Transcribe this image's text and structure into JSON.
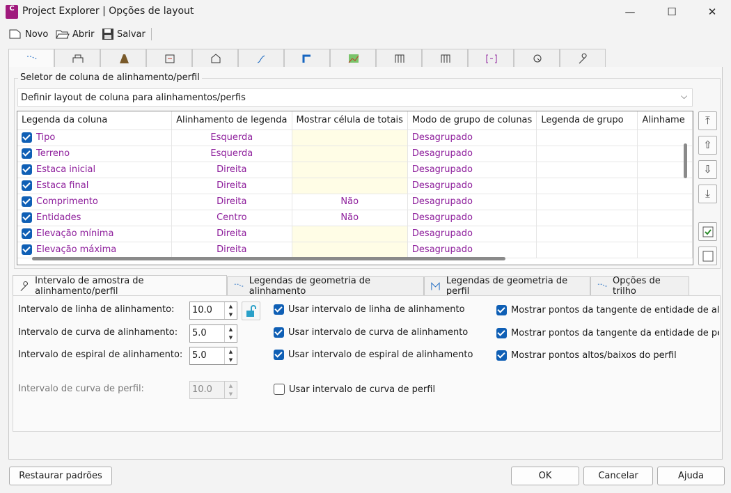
{
  "window": {
    "title": "Project Explorer | Opções de layout",
    "app_icon_text": "C",
    "min": "—",
    "max": "☐",
    "close": "✕"
  },
  "toolbar": {
    "novo": "Novo",
    "abrir": "Abrir",
    "salvar": "Salvar"
  },
  "top_tabs": [
    "alignment-tab-icon",
    "bridge-tab-icon",
    "corridor-tab-icon",
    "assembly-tab-icon",
    "surface-tab-icon",
    "profile-tab-icon",
    "pipe-tab-icon",
    "sample-lines-tab-icon",
    "section-views-tab-icon",
    "structures-tab-icon",
    "station-tab-icon",
    "point-tab-icon",
    "tools-tab-icon"
  ],
  "selector": {
    "legend": "Seletor de coluna de alinhamento/perfil",
    "value": "Definir layout de coluna para alinhamentos/perfis"
  },
  "grid": {
    "headers": [
      "Legenda da coluna",
      "Alinhamento de legenda",
      "Mostrar célula de totais",
      "Modo de grupo de colunas",
      "Legenda de grupo",
      "Alinhame"
    ],
    "rows": [
      {
        "name": "Tipo",
        "align": "Esquerda",
        "totals": "",
        "group": "Desagrupado"
      },
      {
        "name": "Terreno",
        "align": "Esquerda",
        "totals": "",
        "group": "Desagrupado"
      },
      {
        "name": "Estaca inicial",
        "align": "Direita",
        "totals": "",
        "group": "Desagrupado"
      },
      {
        "name": "Estaca final",
        "align": "Direita",
        "totals": "",
        "group": "Desagrupado"
      },
      {
        "name": "Comprimento",
        "align": "Direita",
        "totals": "Não",
        "group": "Desagrupado"
      },
      {
        "name": "Entidades",
        "align": "Centro",
        "totals": "Não",
        "group": "Desagrupado"
      },
      {
        "name": "Elevação mínima",
        "align": "Direita",
        "totals": "",
        "group": "Desagrupado"
      },
      {
        "name": "Elevação máxima",
        "align": "Direita",
        "totals": "",
        "group": "Desagrupado"
      }
    ]
  },
  "side_buttons": {
    "top": "⤒",
    "up": "⇧",
    "down": "⇩",
    "bottom": "⤓"
  },
  "lower_tabs": {
    "t1": "Intervalo de amostra de alinhamento/perfil",
    "t2": "Legendas de geometria de alinhamento",
    "t3": "Legendas de geometria de perfil",
    "t4": "Opções de trilho"
  },
  "intervals": {
    "linha_label": "Intervalo de linha de alinhamento:",
    "linha_value": "10.0",
    "curva_label": "Intervalo de curva de alinhamento:",
    "curva_value": "5.0",
    "espiral_label": "Intervalo de espiral de alinhamento:",
    "espiral_value": "5.0",
    "perfil_label": "Intervalo de curva de perfil:",
    "perfil_value": "10.0"
  },
  "checks": {
    "usar_linha": "Usar intervalo de linha de alinhamento",
    "usar_curva": "Usar intervalo de curva de alinhamento",
    "usar_espiral": "Usar intervalo de espiral de alinhamento",
    "usar_perfil": "Usar intervalo de curva de perfil",
    "tang_alin": "Mostrar pontos da tangente de entidade de alinh",
    "tang_perfil": "Mostrar pontos da tangente da entidade de perfi",
    "altos_baixos": "Mostrar pontos altos/baixos do perfil"
  },
  "footer": {
    "restore": "Restaurar padrões",
    "ok": "OK",
    "cancel": "Cancelar",
    "help": "Ajuda"
  }
}
